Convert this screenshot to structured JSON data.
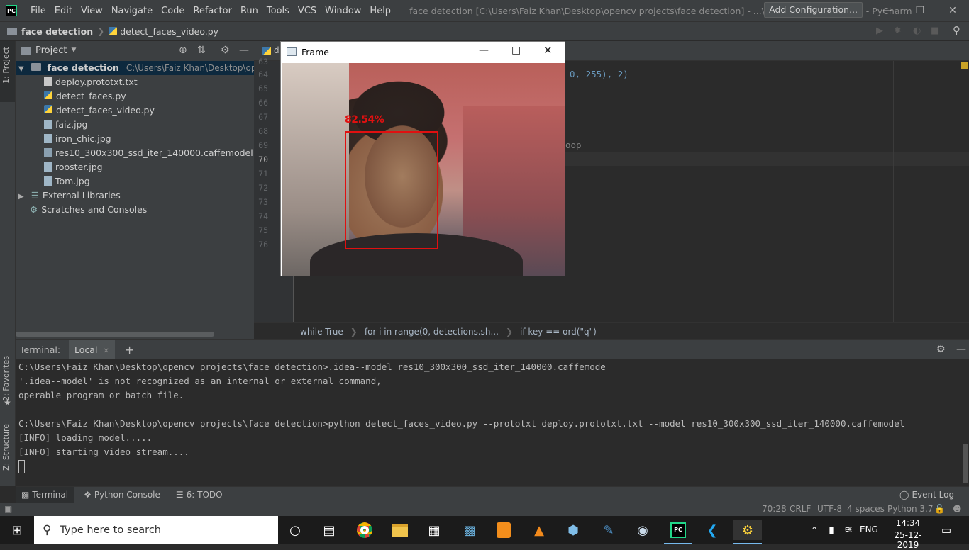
{
  "titlebar": {
    "app_logo": "PC",
    "menu": [
      "File",
      "Edit",
      "View",
      "Navigate",
      "Code",
      "Refactor",
      "Run",
      "Tools",
      "VCS",
      "Window",
      "Help"
    ],
    "window_title": "face detection [C:\\Users\\Faiz Khan\\Desktop\\opencv projects\\face detection] - ...\\detect_faces_video.py - PyCharm"
  },
  "navbar": {
    "project": "face detection",
    "file": "detect_faces_video.py",
    "add_config": "Add Configuration..."
  },
  "stripe": {
    "project_tab": "1: Project",
    "favorites_tab": "2: Favorites",
    "structure_tab": "Z: Structure"
  },
  "project": {
    "header": "Project",
    "root_name": "face detection",
    "root_path": "C:\\Users\\Faiz Khan\\Desktop\\opencv pro",
    "files": [
      "deploy.prototxt.txt",
      "detect_faces.py",
      "detect_faces_video.py",
      "faiz.jpg",
      "iron_chic.jpg",
      "res10_300x300_ssd_iter_140000.caffemodel",
      "rooster.jpg",
      "Tom.jpg"
    ],
    "external_libraries": "External Libraries",
    "scratches": "Scratches and Consoles"
  },
  "editor": {
    "tab_prefix": "d",
    "line_numbers": [
      "63",
      "64",
      "65",
      "66",
      "67",
      "68",
      "69",
      "70",
      "71",
      "72",
      "73",
      "74",
      "75",
      "76"
    ],
    "code_fragment_64": "0, 255), 2)",
    "code_fragment_69": "oop",
    "breadcrumb": [
      "while True",
      "for i in range(0, detections.sh...",
      "if key == ord(\"q\")"
    ]
  },
  "frame_window": {
    "title": "Frame",
    "detection_label": "82.54%",
    "detection_confidence_percent": 82.54
  },
  "terminal": {
    "label": "Terminal:",
    "tab": "Local",
    "lines": [
      "C:\\Users\\Faiz Khan\\Desktop\\opencv projects\\face detection>.idea--model res10_300x300_ssd_iter_140000.caffemode",
      "'.idea--model' is not recognized as an internal or external command,",
      "operable program or batch file.",
      "",
      "C:\\Users\\Faiz Khan\\Desktop\\opencv projects\\face detection>python detect_faces_video.py --prototxt deploy.prototxt.txt --model res10_300x300_ssd_iter_140000.caffemodel",
      "[INFO] loading model.....",
      "[INFO] starting video stream...."
    ]
  },
  "bottom_tabs": {
    "terminal": "Terminal",
    "python_console": "Python Console",
    "todo": "6: TODO",
    "event_log": "Event Log"
  },
  "statusbar": {
    "position": "70:28",
    "line_sep": "CRLF",
    "encoding": "UTF-8",
    "indent": "4 spaces",
    "interpreter": "Python 3.7"
  },
  "taskbar": {
    "search_placeholder": "Type here to search",
    "language": "ENG",
    "time": "14:34",
    "date": "25-12-2019"
  },
  "colors": {
    "accent_red": "#e01010",
    "ide_bg": "#2b2b2b",
    "panel_bg": "#3c3f41",
    "selection": "#0d293e"
  }
}
